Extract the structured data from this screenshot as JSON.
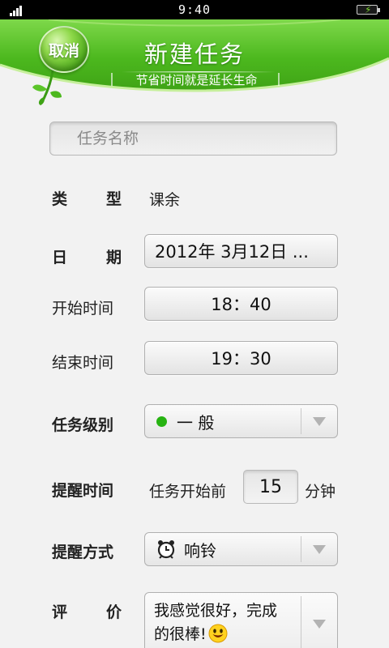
{
  "status_bar": {
    "time": "9:40"
  },
  "header": {
    "cancel_label": "取消",
    "title": "新建任务",
    "subtitle": "节省时间就是延长生命"
  },
  "form": {
    "task_name_placeholder": "任务名称",
    "type": {
      "label_chars": [
        "类",
        "型"
      ],
      "value": "课余"
    },
    "date": {
      "label_chars": [
        "日",
        "期"
      ],
      "value": "2012年 3月12日 ..."
    },
    "start_time": {
      "label": "开始时间",
      "value": "18：40"
    },
    "end_time": {
      "label": "结束时间",
      "value": "19：30"
    },
    "level": {
      "label": "任务级别",
      "value": "一 般",
      "dot_color": "#27b312"
    },
    "reminder_time": {
      "label": "提醒时间",
      "prefix": "任务开始前",
      "minutes": "15",
      "suffix": "分钟"
    },
    "reminder_method": {
      "label": "提醒方式",
      "value": "响铃"
    },
    "evaluation": {
      "label_chars": [
        "评",
        "价"
      ],
      "line1": "我感觉很好，完成",
      "line2": "的很棒!"
    }
  },
  "colors": {
    "accent_green": "#4cb81e",
    "header_green": "#5fcf2a"
  }
}
